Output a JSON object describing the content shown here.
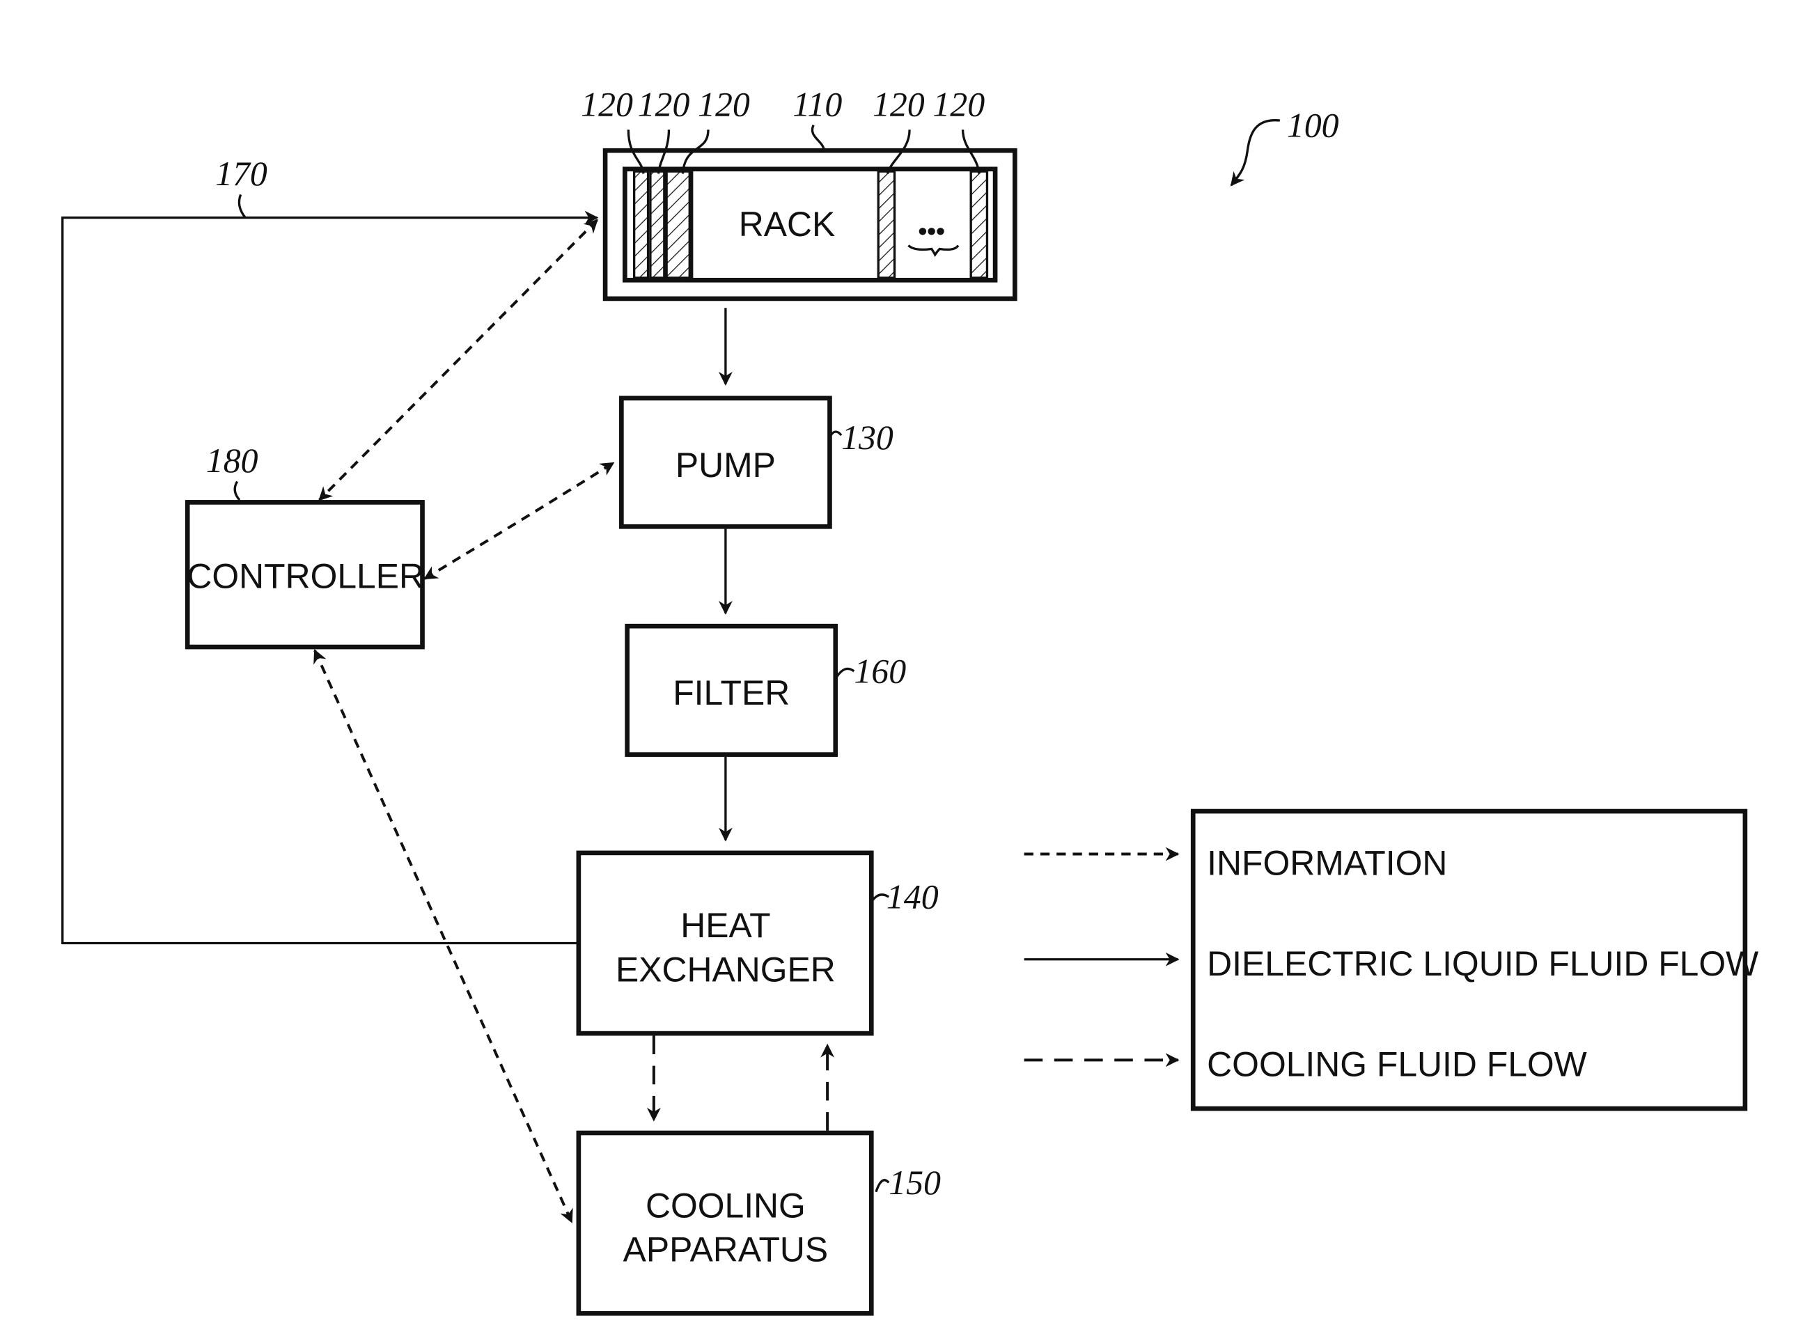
{
  "figure": {
    "reference": "100",
    "colors": {
      "ink": "#111111",
      "background": "#ffffff"
    }
  },
  "rack": {
    "label": "RACK",
    "ref": "110",
    "server_ref": "120",
    "ellipsis": "•••"
  },
  "pump": {
    "label": "PUMP",
    "ref": "130"
  },
  "filter": {
    "label": "FILTER",
    "ref": "160"
  },
  "heat_exchanger": {
    "label_line1": "HEAT",
    "label_line2": "EXCHANGER",
    "ref": "140"
  },
  "cooling_apparatus": {
    "label_line1": "COOLING",
    "label_line2": "APPARATUS",
    "ref": "150"
  },
  "controller": {
    "label": "CONTROLLER",
    "ref": "180"
  },
  "return_line": {
    "ref": "170"
  },
  "legend": {
    "items": [
      {
        "label": "INFORMATION",
        "line_style": "short-dash"
      },
      {
        "label": "DIELECTRIC LIQUID FLUID FLOW",
        "line_style": "solid"
      },
      {
        "label": "COOLING FLUID FLOW",
        "line_style": "long-dash"
      }
    ]
  }
}
